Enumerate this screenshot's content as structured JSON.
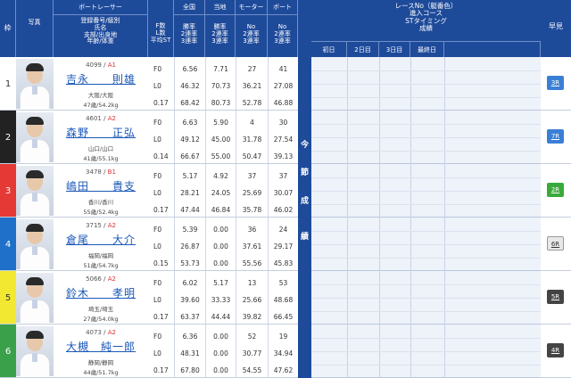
{
  "header": {
    "waku": "枠",
    "photo": "写真",
    "racer": "ボートレーサー",
    "racer_sub": [
      "登録番号/級別",
      "氏名",
      "支部/出身地",
      "年齢/体重"
    ],
    "flst": [
      "F数",
      "L数",
      "平均ST"
    ],
    "zenkoku": "全国",
    "touchi": "当地",
    "motor": "モーター",
    "boat": "ボート",
    "rates_a": [
      "勝率",
      "2連率",
      "3連率"
    ],
    "rates_b": [
      "No",
      "2連率",
      "3連率"
    ],
    "right_title": [
      "レースNo（艇番色）",
      "進入コース",
      "STタイミング",
      "成績"
    ],
    "days": [
      "初日",
      "2日目",
      "3日目",
      "最終日"
    ],
    "hayami": "早見",
    "vertical": [
      "今",
      "節",
      "成",
      "績"
    ]
  },
  "rows": [
    {
      "num": "1",
      "color": "#ffffff",
      "fg": "#333333",
      "id": "4099 / ",
      "cls": "A1",
      "name": "吉永　　則雄",
      "home": "大阪/大阪",
      "age": "47歳/54.2kg",
      "fl": [
        "F0",
        "L0",
        "0.17"
      ],
      "zen": [
        "6.56",
        "46.32",
        "68.42"
      ],
      "tou": [
        "7.71",
        "70.73",
        "80.73"
      ],
      "mot": [
        "27",
        "36.21",
        "52.78"
      ],
      "boa": [
        "41",
        "27.08",
        "46.88"
      ],
      "hayami": "3R",
      "hcolor": "#3a7fd5",
      "hdark": false
    },
    {
      "num": "2",
      "color": "#222222",
      "fg": "#ffffff",
      "id": "4601 / ",
      "cls": "A2",
      "name": "森野　　正弘",
      "home": "山口/山口",
      "age": "41歳/55.1kg",
      "fl": [
        "F0",
        "L0",
        "0.14"
      ],
      "zen": [
        "6.63",
        "49.12",
        "66.67"
      ],
      "tou": [
        "5.90",
        "45.00",
        "55.00"
      ],
      "mot": [
        "4",
        "31.78",
        "50.47"
      ],
      "boa": [
        "30",
        "27.54",
        "39.13"
      ],
      "hayami": "7R",
      "hcolor": "#3a7fd5",
      "hdark": false
    },
    {
      "num": "3",
      "color": "#e53935",
      "fg": "#ffffff",
      "id": "3478 / ",
      "cls": "B1",
      "name": "嶋田　　貴支",
      "home": "香川/香川",
      "age": "55歳/52.4kg",
      "fl": [
        "F0",
        "L0",
        "0.17"
      ],
      "zen": [
        "5.17",
        "28.21",
        "47.44"
      ],
      "tou": [
        "4.92",
        "24.05",
        "46.84"
      ],
      "mot": [
        "37",
        "25.69",
        "35.78"
      ],
      "boa": [
        "37",
        "30.07",
        "46.02"
      ],
      "hayami": "2R",
      "hcolor": "#3aaa3a",
      "hdark": false
    },
    {
      "num": "4",
      "color": "#1e70c8",
      "fg": "#ffffff",
      "id": "3715 / ",
      "cls": "A2",
      "name": "倉尾　　大介",
      "home": "福岡/福岡",
      "age": "51歳/54.7kg",
      "fl": [
        "F0",
        "L0",
        "0.15"
      ],
      "zen": [
        "5.39",
        "26.87",
        "53.73"
      ],
      "tou": [
        "0.00",
        "0.00",
        "0.00"
      ],
      "mot": [
        "36",
        "37.61",
        "55.56"
      ],
      "boa": [
        "24",
        "29.17",
        "45.83"
      ],
      "hayami": "6R",
      "hcolor": "#e8e8e8",
      "hdark": true
    },
    {
      "num": "5",
      "color": "#f2e832",
      "fg": "#333333",
      "id": "5066 / ",
      "cls": "A2",
      "name": "鈴木　　孝明",
      "home": "埼玉/埼玉",
      "age": "27歳/54.0kg",
      "fl": [
        "F0",
        "L0",
        "0.17"
      ],
      "zen": [
        "6.02",
        "39.60",
        "63.37"
      ],
      "tou": [
        "5.17",
        "33.33",
        "44.44"
      ],
      "mot": [
        "13",
        "25.66",
        "39.82"
      ],
      "boa": [
        "53",
        "48.68",
        "66.45"
      ],
      "hayami": "5R",
      "hcolor": "#444444",
      "hdark": false
    },
    {
      "num": "6",
      "color": "#3aa04a",
      "fg": "#ffffff",
      "id": "4073 / ",
      "cls": "A2",
      "name": "大槻　純一郎",
      "home": "静岡/静岡",
      "age": "44歳/51.7kg",
      "fl": [
        "F0",
        "L0",
        "0.17"
      ],
      "zen": [
        "6.36",
        "48.31",
        "67.80"
      ],
      "tou": [
        "0.00",
        "0.00",
        "0.00"
      ],
      "mot": [
        "52",
        "30.77",
        "54.55"
      ],
      "boa": [
        "19",
        "34.94",
        "47.62"
      ],
      "hayami": "4R",
      "hcolor": "#444444",
      "hdark": false
    }
  ]
}
